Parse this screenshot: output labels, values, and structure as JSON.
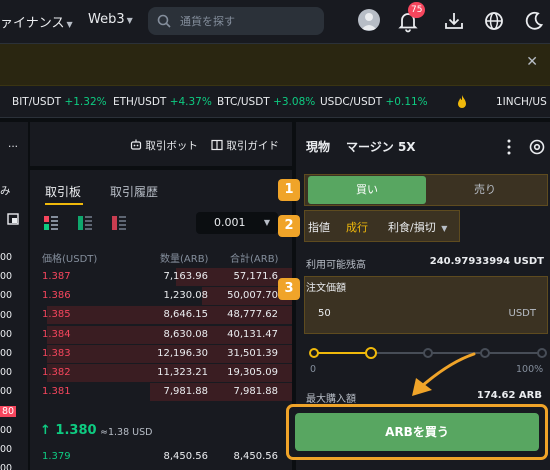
{
  "header": {
    "nav_finance": "ァイナンス",
    "nav_web3": "Web3",
    "search_placeholder": "通貨を探す",
    "notification_count": "75"
  },
  "ticker": [
    {
      "pair": "BIT/USDT",
      "change": "+1.32%"
    },
    {
      "pair": "ETH/USDT",
      "change": "+4.37%"
    },
    {
      "pair": "BTC/USDT",
      "change": "+3.08%"
    },
    {
      "pair": "USDC/USDT",
      "change": "+0.11%"
    },
    {
      "pair": "1INCH/US",
      "change": ""
    }
  ],
  "left_panel": {
    "truncated_label": "み",
    "more": "...",
    "trading_bot": "取引ボット",
    "trading_guide": "取引ガイド"
  },
  "orderbook": {
    "tab_book": "取引板",
    "tab_history": "取引履歴",
    "tick_size": "0.001",
    "col_price": "価格(USDT)",
    "col_amount": "数量(ARB)",
    "col_total": "合計(ARB)",
    "asks": [
      {
        "price": "1.387",
        "amount": "7,163.96",
        "total": "57,171.6",
        "depth": 0.45
      },
      {
        "price": "1.386",
        "amount": "1,230.08",
        "total": "50,007.70",
        "depth": 0.35
      },
      {
        "price": "1.385",
        "amount": "8,646.15",
        "total": "48,777.62",
        "depth": 0.95
      },
      {
        "price": "1.384",
        "amount": "8,630.08",
        "total": "40,131.47",
        "depth": 0.95
      },
      {
        "price": "1.383",
        "amount": "12,196.30",
        "total": "31,501.39",
        "depth": 0.95
      },
      {
        "price": "1.382",
        "amount": "11,323.21",
        "total": "19,305.09",
        "depth": 0.95
      },
      {
        "price": "1.381",
        "amount": "7,981.88",
        "total": "7,981.88",
        "depth": 0.55
      }
    ],
    "last_price": "1.380",
    "last_price_approx": "≈1.38 USD",
    "bid_partial": {
      "price": "1.379",
      "amount": "8,450.56",
      "total": "8,450.56"
    },
    "edge_values": [
      "00",
      "00",
      "00",
      "00",
      "00",
      "00",
      "00",
      "00",
      "80",
      "00",
      "00",
      "00"
    ]
  },
  "order_panel": {
    "tab_spot": "現物",
    "tab_margin": "マージン 5X",
    "buy": "買い",
    "sell": "売り",
    "type_limit": "指値",
    "type_market": "成行",
    "type_tpsl": "利食/損切",
    "available_label": "利用可能残高",
    "available_value": "240.97933994 USDT",
    "price_label": "注文価額",
    "price_value": "50",
    "price_unit": "USDT",
    "slider_min": "0",
    "slider_max": "100%",
    "slider_value": 0.25,
    "max_buy_label": "最大購入額",
    "max_buy_value": "174.62 ARB",
    "buy_button": "ARBを買う"
  },
  "steps": [
    "1",
    "2",
    "3"
  ],
  "colors": {
    "accent": "#f0b90b",
    "up": "#0ecb81",
    "down": "#f6465d",
    "buy_button": "#58a661",
    "highlight": "#f0a429"
  }
}
